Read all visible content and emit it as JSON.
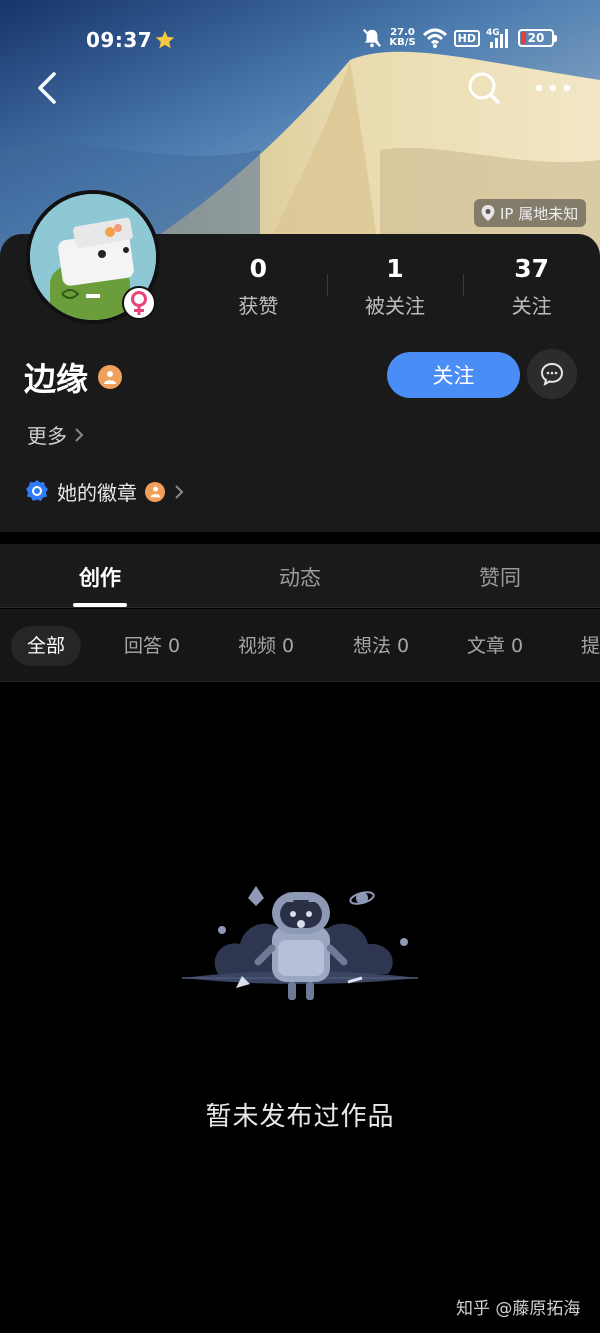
{
  "status_bar": {
    "time": "09:37",
    "net_speed_value": "27.0",
    "net_speed_unit": "KB/S",
    "hd_label": "HD",
    "network_label": "4G",
    "battery_level": "20"
  },
  "ip_location": "IP 属地未知",
  "profile": {
    "name": "边缘",
    "gender_icon": "female-icon"
  },
  "stats": [
    {
      "value": "0",
      "label": "获赞"
    },
    {
      "value": "1",
      "label": "被关注"
    },
    {
      "value": "37",
      "label": "关注"
    }
  ],
  "actions": {
    "follow_label": "关注"
  },
  "more_label": "更多",
  "badges_label": "她的徽章",
  "tabs": [
    {
      "label": "创作"
    },
    {
      "label": "动态"
    },
    {
      "label": "赞同"
    }
  ],
  "filters": [
    {
      "label": "全部"
    },
    {
      "label": "回答 0"
    },
    {
      "label": "视频 0"
    },
    {
      "label": "想法 0"
    },
    {
      "label": "文章 0"
    },
    {
      "label": "提"
    }
  ],
  "empty_message": "暂未发布过作品",
  "watermark": "知乎 @藤原拓海",
  "colors": {
    "accent": "#4a8df6",
    "card_bg": "#1a1a1a",
    "badge_orange": "#f0a05a",
    "battery_low": "#e83b3b"
  }
}
